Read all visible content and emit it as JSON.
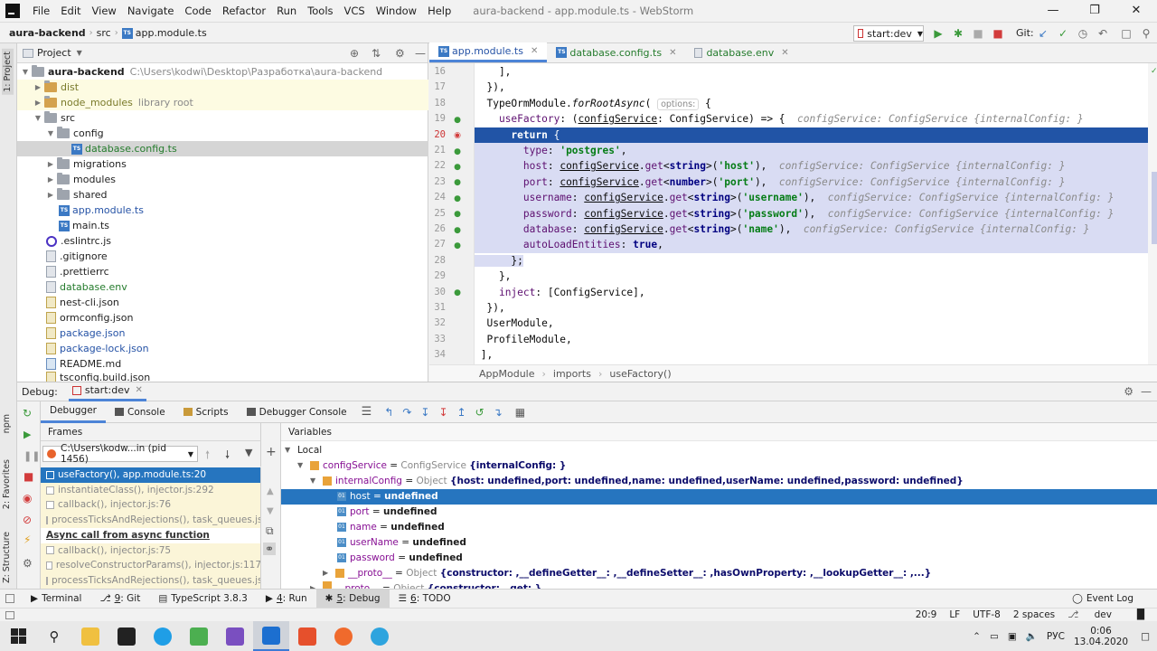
{
  "window": {
    "title": "aura-backend - app.module.ts - WebStorm"
  },
  "menu": [
    "File",
    "Edit",
    "View",
    "Navigate",
    "Code",
    "Refactor",
    "Run",
    "Tools",
    "VCS",
    "Window",
    "Help"
  ],
  "navbar": {
    "project": "aura-backend",
    "folder": "src",
    "file": "app.module.ts",
    "run_config": "start:dev",
    "git_label": "Git:"
  },
  "project_panel": {
    "title": "Project",
    "root_name": "aura-backend",
    "root_path": "C:\\Users\\kodwi\\Desktop\\Разработка\\aura-backend",
    "items": [
      {
        "label": "dist",
        "hint": ""
      },
      {
        "label": "node_modules",
        "hint": "library root"
      },
      {
        "label": "src",
        "hint": ""
      },
      {
        "label": "config",
        "hint": ""
      },
      {
        "label": "database.config.ts",
        "hint": ""
      },
      {
        "label": "migrations",
        "hint": ""
      },
      {
        "label": "modules",
        "hint": ""
      },
      {
        "label": "shared",
        "hint": ""
      },
      {
        "label": "app.module.ts",
        "hint": ""
      },
      {
        "label": "main.ts",
        "hint": ""
      },
      {
        "label": ".eslintrc.js",
        "hint": ""
      },
      {
        "label": ".gitignore",
        "hint": ""
      },
      {
        "label": ".prettierrc",
        "hint": ""
      },
      {
        "label": "database.env",
        "hint": ""
      },
      {
        "label": "nest-cli.json",
        "hint": ""
      },
      {
        "label": "ormconfig.json",
        "hint": ""
      },
      {
        "label": "package.json",
        "hint": ""
      },
      {
        "label": "package-lock.json",
        "hint": ""
      },
      {
        "label": "README.md",
        "hint": ""
      },
      {
        "label": "tsconfig.build.json",
        "hint": ""
      }
    ]
  },
  "editor": {
    "tabs": [
      {
        "label": "app.module.ts"
      },
      {
        "label": "database.config.ts"
      },
      {
        "label": "database.env"
      }
    ],
    "line_numbers": [
      "16",
      "17",
      "18",
      "19",
      "20",
      "21",
      "22",
      "23",
      "24",
      "25",
      "26",
      "27",
      "28",
      "29",
      "30",
      "31",
      "32",
      "33",
      "34"
    ],
    "hints": {
      "options": "options:",
      "config_service": "configService: ConfigService {internalConfig: }"
    },
    "breadcrumb": [
      "AppModule",
      "imports",
      "useFactory()"
    ]
  },
  "debug": {
    "label": "Debug:",
    "config": "start:dev",
    "tabs": [
      "Debugger",
      "Console",
      "Scripts",
      "Debugger Console"
    ],
    "frames_title": "Frames",
    "variables_title": "Variables",
    "process": "C:\\Users\\kodw...in (pid 1456)",
    "frames": [
      "useFactory(), app.module.ts:20",
      "instantiateClass(), injector.js:292",
      "callback(), injector.js:76",
      "processTicksAndRejections(), task_queues.js:97",
      "Async call from async function",
      "callback(), injector.js:75",
      "resolveConstructorParams(), injector.js:117",
      "processTicksAndRejections(), task_queues.js:97"
    ],
    "variables": {
      "local": "Local",
      "config_service": {
        "name": "configService",
        "type": "ConfigService",
        "value": "{internalConfig: }"
      },
      "internal_config": {
        "name": "internalConfig",
        "type": "Object",
        "value": "{host: undefined,port: undefined,name: undefined,userName: undefined,password: undefined}"
      },
      "fields": [
        {
          "name": "host",
          "value": "undefined"
        },
        {
          "name": "port",
          "value": "undefined"
        },
        {
          "name": "name",
          "value": "undefined"
        },
        {
          "name": "userName",
          "value": "undefined"
        },
        {
          "name": "password",
          "value": "undefined"
        }
      ],
      "proto1": {
        "name": "__proto__",
        "type": "Object",
        "value": "{constructor: ,__defineGetter__: ,__defineSetter__: ,hasOwnProperty: ,__lookupGetter__: ,...}"
      },
      "proto2": {
        "name": "__proto__",
        "type": "Object",
        "value": "{constructor: , get: }"
      }
    }
  },
  "tool_windows": [
    {
      "label": "Terminal",
      "mnemonic": ""
    },
    {
      "label": "Git",
      "mnemonic": "9"
    },
    {
      "label": "TypeScript 3.8.3",
      "mnemonic": ""
    },
    {
      "label": "Run",
      "mnemonic": "4"
    },
    {
      "label": "Debug",
      "mnemonic": "5"
    },
    {
      "label": "TODO",
      "mnemonic": "6"
    }
  ],
  "event_log": "Event Log",
  "status": {
    "position": "20:9",
    "line_sep": "LF",
    "encoding": "UTF-8",
    "indent": "2 spaces",
    "branch": "dev"
  },
  "left_stripe": {
    "project": "1: Project",
    "favorites": "2: Favorites",
    "structure": "Z: Structure",
    "npm": "npm"
  },
  "taskbar": {
    "lang": "РУС",
    "time": "0:06",
    "date": "13.04.2020"
  }
}
